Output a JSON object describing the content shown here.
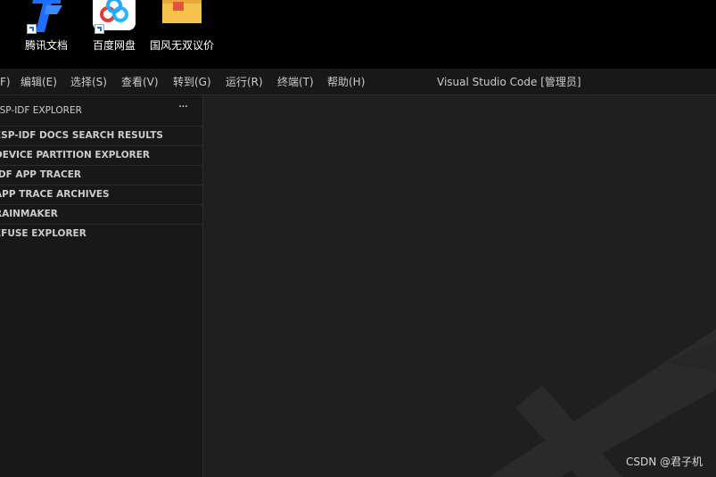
{
  "desktop": {
    "icons": [
      {
        "label": "腾讯文档",
        "icon": "tencent-docs-icon"
      },
      {
        "label": "百度网盘",
        "icon": "baidu-netdisk-icon"
      },
      {
        "label": "国风无双议价",
        "icon": "folder-icon"
      }
    ]
  },
  "titlebar": {
    "menu": [
      "F)",
      "编辑(E)",
      "选择(S)",
      "查看(V)",
      "转到(G)",
      "运行(R)",
      "终端(T)",
      "帮助(H)"
    ],
    "window_title": "Visual Studio Code [管理员]"
  },
  "sidebar": {
    "title": "ESP-IDF EXPLORER",
    "more_label": "···",
    "sections": [
      "ESP-IDF DOCS SEARCH RESULTS",
      "DEVICE PARTITION EXPLORER",
      "IDF APP TRACER",
      "APP TRACE ARCHIVES",
      "RAINMAKER",
      "EFUSE EXPLORER"
    ]
  },
  "watermark_text": "CSDN @君子机",
  "colors": {
    "sidebar_bg": "#181818",
    "editor_bg": "#1f1f1f",
    "text": "#cccccc",
    "border": "#2b2b2b"
  }
}
